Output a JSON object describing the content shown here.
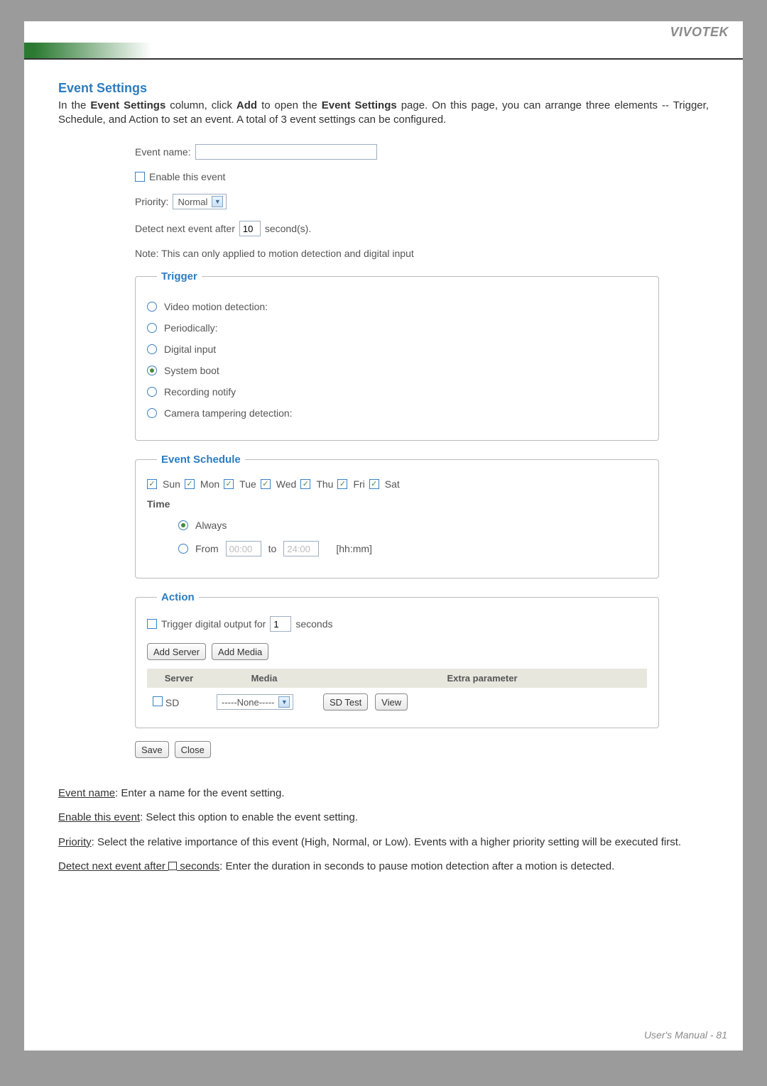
{
  "brand": "VIVOTEK",
  "heading": "Event Settings",
  "intro_parts": {
    "p1": "In the ",
    "b1": "Event Settings",
    "p2": " column, click ",
    "b2": "Add",
    "p3": " to open the ",
    "b3": "Event Settings",
    "p4": " page. On this page, you can arrange three elements -- Trigger, Schedule, and Action to set an event. A total of 3 event settings can be configured."
  },
  "form": {
    "eventNameLabel": "Event name:",
    "eventNameValue": "",
    "enableLabel": "Enable this event",
    "enableChecked": false,
    "priorityLabel": "Priority:",
    "priorityValue": "Normal",
    "detectPrefix": "Detect next event after",
    "detectValue": "10",
    "detectSuffix": "second(s).",
    "note": "Note: This can only applied to motion detection and digital input"
  },
  "trigger": {
    "legend": "Trigger",
    "options": [
      {
        "label": "Video motion detection:",
        "selected": false
      },
      {
        "label": "Periodically:",
        "selected": false
      },
      {
        "label": "Digital input",
        "selected": false
      },
      {
        "label": "System boot",
        "selected": true
      },
      {
        "label": "Recording notify",
        "selected": false
      },
      {
        "label": "Camera tampering detection:",
        "selected": false
      }
    ]
  },
  "schedule": {
    "legend": "Event Schedule",
    "days": [
      "Sun",
      "Mon",
      "Tue",
      "Wed",
      "Thu",
      "Fri",
      "Sat"
    ],
    "timeLabel": "Time",
    "alwaysLabel": "Always",
    "fromLabel": "From",
    "fromValue": "00:00",
    "toLabel": "to",
    "toValue": "24:00",
    "hint": "[hh:mm]",
    "alwaysSelected": true
  },
  "action": {
    "legend": "Action",
    "trigOutPrefix": "Trigger digital output for",
    "trigOutValue": "1",
    "trigOutSuffix": "seconds",
    "addServer": "Add Server",
    "addMedia": "Add Media",
    "headers": {
      "c1": "Server",
      "c2": "Media",
      "c3": "Extra parameter"
    },
    "rowSDLabel": "SD",
    "mediaSelect": "-----None-----",
    "sdTest": "SD Test",
    "view": "View"
  },
  "buttons": {
    "save": "Save",
    "close": "Close"
  },
  "descriptions": {
    "d1a": "Event name",
    "d1b": ": Enter a name for the event setting.",
    "d2a": "Enable this event",
    "d2b": ": Select this option to enable the event setting.",
    "d3a": "Priority",
    "d3b": ": Select the relative importance of this event (High, Normal, or Low). Events with a higher priority setting will be executed first.",
    "d4a": "Detect next event after ",
    "d4b": " seconds",
    "d4c": ": Enter the duration in seconds to pause motion detection after a motion is detected."
  },
  "footer": {
    "label": "User's Manual - ",
    "pageNum": "81"
  }
}
